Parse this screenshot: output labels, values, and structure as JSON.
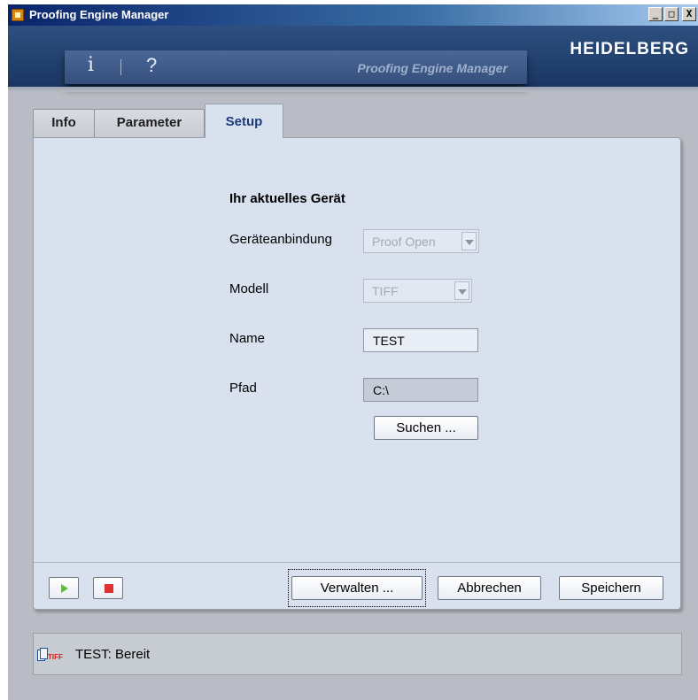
{
  "window": {
    "title": "Proofing Engine Manager",
    "buttons": {
      "minimize": "_",
      "maximize": "□",
      "close": "X"
    }
  },
  "header": {
    "info_icon": "i",
    "help_icon": "?",
    "subtitle": "Proofing Engine Manager",
    "brand": "HEIDELBERG"
  },
  "tabs": [
    {
      "label": "Info"
    },
    {
      "label": "Parameter"
    },
    {
      "label": "Setup",
      "active": true
    }
  ],
  "setup": {
    "section_title": "Ihr aktuelles Gerät",
    "connection_label": "Geräteanbindung",
    "connection_value": "Proof Open",
    "model_label": "Modell",
    "model_value": "TIFF",
    "name_label": "Name",
    "name_value": "TEST",
    "path_label": "Pfad",
    "path_value": "C:\\",
    "browse_button": "Suchen ..."
  },
  "footer": {
    "manage_button": "Verwalten ...",
    "cancel_button": "Abbrechen",
    "save_button": "Speichern"
  },
  "status": {
    "icon": "tiff-file-icon",
    "icon_text": "TIFF",
    "text": "TEST: Bereit"
  },
  "colors": {
    "header_bg": "#1f3d6a",
    "panel_bg": "#d9e1ee",
    "active_tab_text": "#1c3a7a",
    "play_green": "#5cbf3a",
    "stop_red": "#e03131"
  }
}
